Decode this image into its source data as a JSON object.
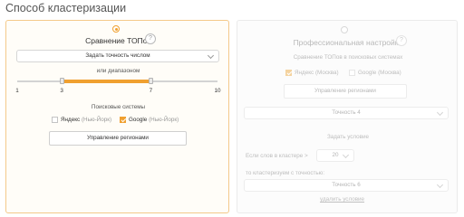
{
  "page": {
    "title": "Способ кластеризации"
  },
  "left_card": {
    "title": "Сравнение ТОПов",
    "help": "?",
    "mode_select": "Задать точность числом",
    "range_label": "или диапазоном",
    "slider": {
      "min": 1,
      "max": 10,
      "low": 3,
      "high": 7
    },
    "tick_labels": [
      "1",
      "3",
      "7",
      "10"
    ],
    "engines_label": "Поисковые системы",
    "yandex": {
      "name": "Яндекс",
      "region": "(Нью-Йорк)",
      "checked": false
    },
    "google": {
      "name": "Google",
      "region": "(Нью-Йорк)",
      "checked": true
    },
    "regions_button": "Управление регионами"
  },
  "right_card": {
    "title": "Профессиональная настройка",
    "help": "?",
    "compare_label": "Сравнение ТОПов в поисковых системах",
    "yandex": {
      "name": "Яндекс",
      "region": "(Москва)",
      "checked": true
    },
    "google": {
      "name": "Google",
      "region": "(Москва)",
      "checked": false
    },
    "regions_button": "Управление регионами",
    "precision_select": "Точность 4",
    "condition_label": "Задать условие",
    "words_label": "Если слов в кластере >",
    "words_select": "20",
    "then_label": "то кластеризуем с точностью:",
    "precision_select_2": "Точность 6",
    "delete_link": "удалить условие"
  },
  "colors": {
    "accent": "#f0a030",
    "border_active": "#f4c98a"
  }
}
